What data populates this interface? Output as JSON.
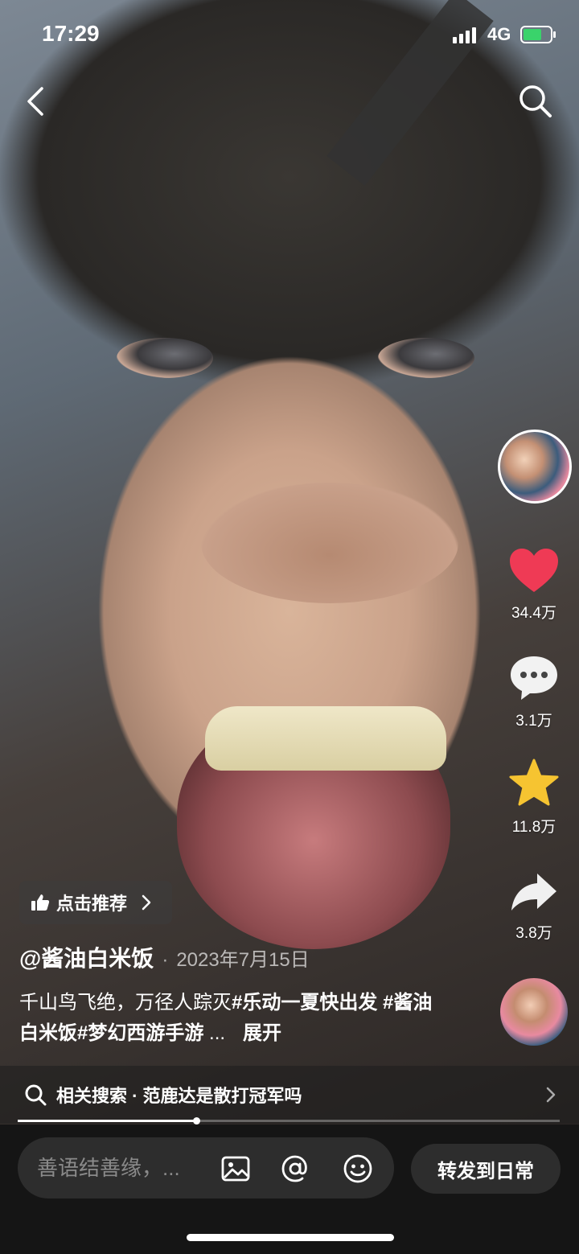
{
  "status_bar": {
    "time": "17:29",
    "network": "4G",
    "battery_color": "#3ad36b"
  },
  "actions": {
    "likes": "34.4万",
    "comments": "3.1万",
    "favorites": "11.8万",
    "shares": "3.8万",
    "like_color": "#ef3a55",
    "favorite_color": "#f6c431"
  },
  "recommend": {
    "label": "点击推荐"
  },
  "post": {
    "author": "@酱油白米饭",
    "separator": "·",
    "date": "2023年7月15日",
    "caption_text": "千山鸟飞绝，万径人踪灭",
    "tag1": "#乐动一夏快出发",
    "tag2": " #酱油白米饭",
    "tag3": "#梦幻西游手游",
    "ellipsis": " ...",
    "expand": "展开"
  },
  "related_search": {
    "text": "相关搜索 · 范鹿达是散打冠军吗"
  },
  "progress": {
    "fraction": 0.33
  },
  "comment_bar": {
    "placeholder": "善语结善缘，...",
    "forward_label": "转发到日常"
  }
}
